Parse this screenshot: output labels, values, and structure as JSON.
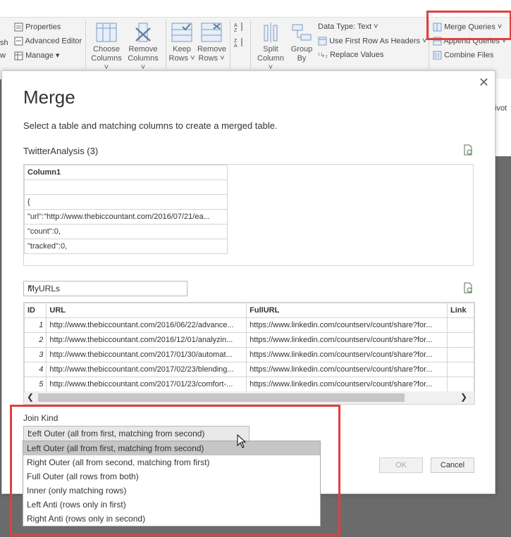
{
  "ribbon": {
    "properties": "Properties",
    "advanced_editor": "Advanced Editor",
    "manage": "Manage",
    "refresh_partial": "sh",
    "refresh_partial2": "w",
    "choose_columns": [
      "Choose",
      "Columns"
    ],
    "remove_columns": [
      "Remove",
      "Columns"
    ],
    "keep_rows": [
      "Keep",
      "Rows"
    ],
    "remove_rows": [
      "Remove",
      "Rows"
    ],
    "split_column": [
      "Split",
      "Column"
    ],
    "group_by": [
      "Group",
      "By"
    ],
    "data_type": "Data Type: Text",
    "first_row_headers": "Use First Row As Headers",
    "replace_values": "Replace Values",
    "merge_queries": "Merge Queries",
    "append_queries": "Append Queries",
    "combine_files": "Combine Files",
    "right_partial": "ivot"
  },
  "dialog": {
    "title": "Merge",
    "description": "Select a table and matching columns to create a merged table.",
    "table1_name": "TwitterAnalysis (3)",
    "table1": {
      "header": "Column1",
      "rows": [
        "",
        "{",
        "\"url\":\"http://www.thebiccountant.com/2016/07/21/ea...",
        "\"count\":0,",
        "\"tracked\":0,"
      ]
    },
    "table2_select": "MyURLs",
    "table2": {
      "headers": [
        "ID",
        "URL",
        "FullURL",
        "Link"
      ],
      "rows": [
        [
          "1",
          "http://www.thebiccountant.com/2016/06/22/advance...",
          "https://www.linkedin.com/countserv/count/share?for...",
          ""
        ],
        [
          "2",
          "http://www.thebiccountant.com/2016/12/01/analyzin...",
          "https://www.linkedin.com/countserv/count/share?for...",
          ""
        ],
        [
          "3",
          "http://www.thebiccountant.com/2017/01/30/automat...",
          "https://www.linkedin.com/countserv/count/share?for...",
          ""
        ],
        [
          "4",
          "http://www.thebiccountant.com/2017/02/23/blending...",
          "https://www.linkedin.com/countserv/count/share?for...",
          ""
        ],
        [
          "5",
          "http://www.thebiccountant.com/2017/01/23/comfort-...",
          "https://www.linkedin.com/countserv/count/share?for...",
          ""
        ]
      ]
    },
    "join_kind_label": "Join Kind",
    "join_kind_value": "Left Outer (all from first, matching from second)",
    "join_options": [
      "Left Outer (all from first, matching from second)",
      "Right Outer (all from second, matching from first)",
      "Full Outer (all rows from both)",
      "Inner (only matching rows)",
      "Left Anti (rows only in first)",
      "Right Anti (rows only in second)"
    ],
    "ok": "OK",
    "cancel": "Cancel"
  },
  "colors": {
    "highlight": "#e04040",
    "selected_option": "#c6c6c6"
  }
}
